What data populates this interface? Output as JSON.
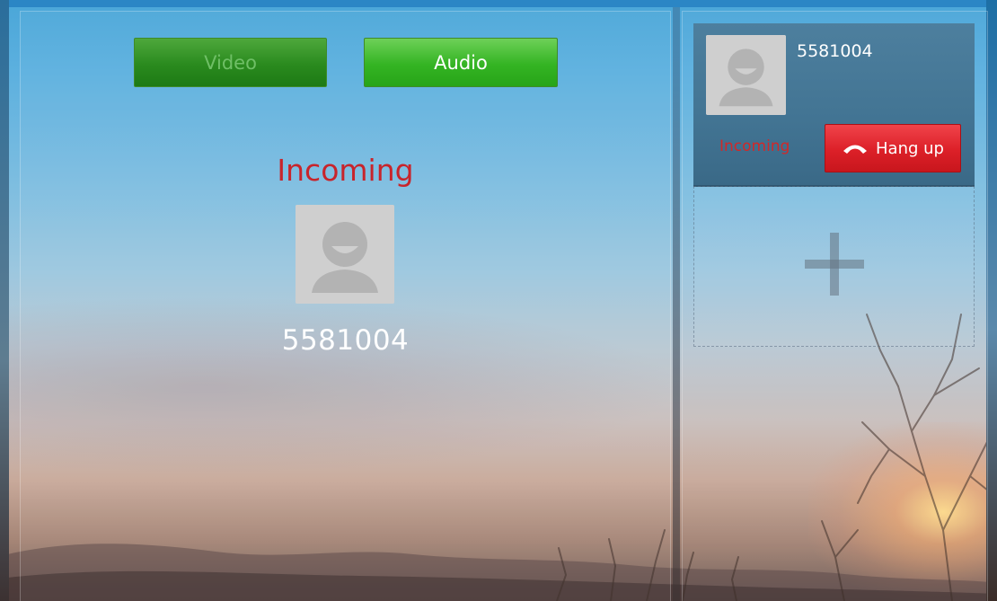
{
  "call_actions": {
    "video_label": "Video",
    "audio_label": "Audio"
  },
  "main_call": {
    "status": "Incoming",
    "number": "5581004",
    "avatar_icon": "default-avatar-icon"
  },
  "call_list": {
    "items": [
      {
        "number": "5581004",
        "status": "Incoming",
        "hangup_label": "Hang up",
        "hangup_icon": "phone-hangup-icon"
      }
    ],
    "add_icon": "plus-icon"
  },
  "colors": {
    "status_red": "#c8242b",
    "audio_green": "#34b423",
    "hangup_red": "#dc2028",
    "card_blue": "#457796"
  }
}
